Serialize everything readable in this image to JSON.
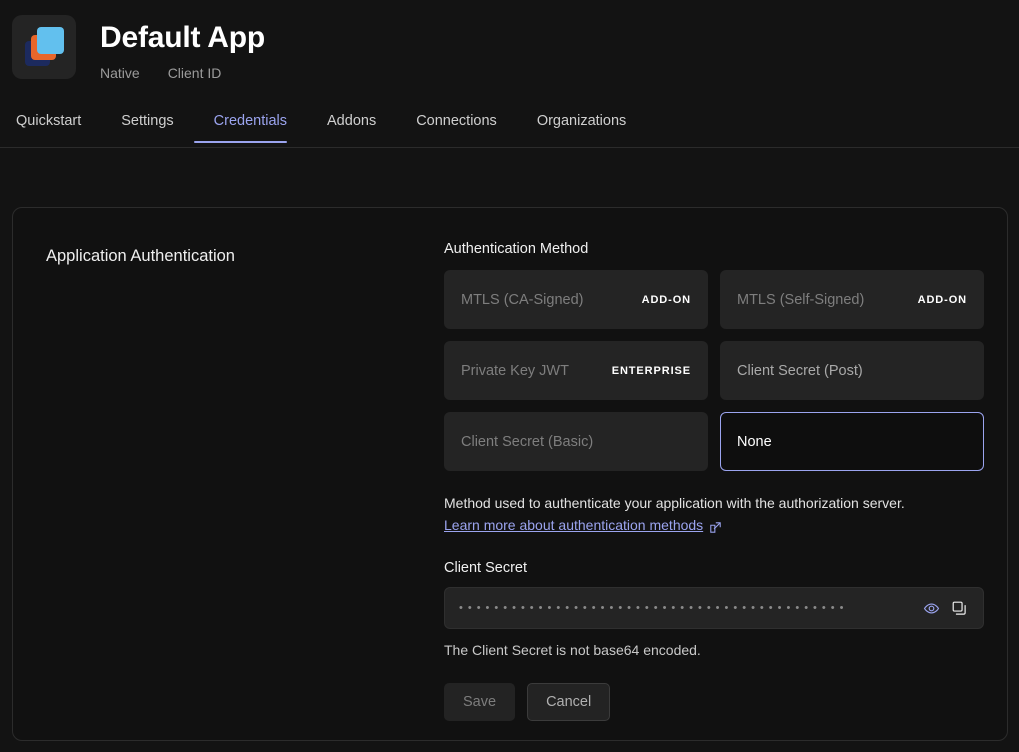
{
  "header": {
    "title": "Default App",
    "app_type": "Native",
    "client_id_label": "Client ID",
    "icon_name": "app-stacked-squares-icon",
    "colors": {
      "icon_back": "#1c2a5e",
      "icon_mid": "#e8662a",
      "icon_front": "#62c0ee"
    }
  },
  "tabs": [
    {
      "label": "Quickstart",
      "active": false
    },
    {
      "label": "Settings",
      "active": false
    },
    {
      "label": "Credentials",
      "active": true
    },
    {
      "label": "Addons",
      "active": false
    },
    {
      "label": "Connections",
      "active": false
    },
    {
      "label": "Organizations",
      "active": false
    }
  ],
  "card": {
    "heading": "Application Authentication",
    "auth_method": {
      "label": "Authentication Method",
      "options": [
        {
          "label": "MTLS (CA-Signed)",
          "badge": "ADD-ON",
          "state": "disabled",
          "selected": false
        },
        {
          "label": "MTLS (Self-Signed)",
          "badge": "ADD-ON",
          "state": "disabled",
          "selected": false
        },
        {
          "label": "Private Key JWT",
          "badge": "ENTERPRISE",
          "state": "disabled",
          "selected": false
        },
        {
          "label": "Client Secret (Post)",
          "badge": "",
          "state": "enabled",
          "selected": false
        },
        {
          "label": "Client Secret (Basic)",
          "badge": "",
          "state": "disabled",
          "selected": false
        },
        {
          "label": "None",
          "badge": "",
          "state": "enabled",
          "selected": true
        }
      ],
      "description": "Method used to authenticate your application with the authorization server.",
      "link_text": "Learn more about authentication methods"
    },
    "client_secret": {
      "label": "Client Secret",
      "masked_value": "••••••••••••••••••••••••••••••••••••••••••••",
      "reveal_icon": "eye-icon",
      "copy_icon": "copy-icon",
      "hint": "The Client Secret is not base64 encoded."
    },
    "actions": {
      "save_label": "Save",
      "cancel_label": "Cancel"
    }
  },
  "colors": {
    "accent": "#9ba4ef",
    "page_background": "#131313",
    "card_background": "#111111",
    "option_background": "#242424"
  }
}
